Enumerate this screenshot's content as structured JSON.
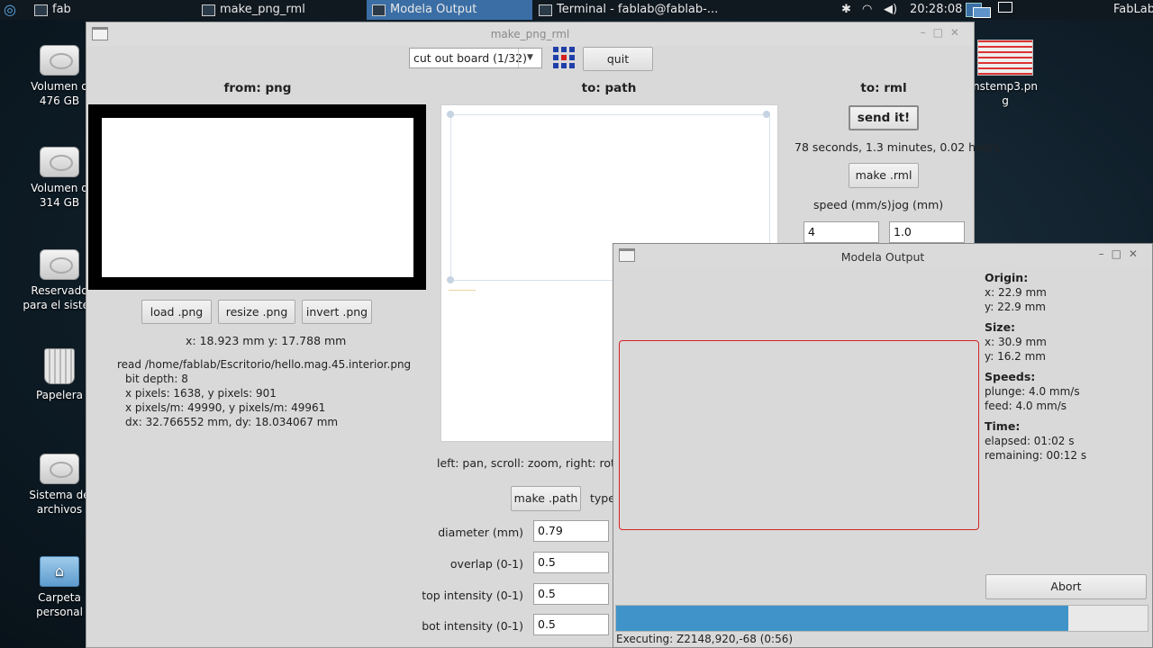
{
  "taskbar": {
    "items": [
      {
        "label": "fab"
      },
      {
        "label": "make_png_rml"
      },
      {
        "label": "Modela Output"
      },
      {
        "label": "Terminal - fablab@fablab-..."
      }
    ],
    "clock": "20:28:08",
    "user": "FabLab"
  },
  "desktop": {
    "icons": [
      {
        "label": "Volumen d\n476 GB"
      },
      {
        "label": "Volumen d\n314 GB"
      },
      {
        "label": "Reservado\npara el sisten"
      },
      {
        "label": "Papelera"
      },
      {
        "label": "Sistema de\narchivos"
      },
      {
        "label": "Carpeta\npersonal"
      },
      {
        "label": "nstemp3.pn\ng"
      }
    ]
  },
  "main_window": {
    "title": "make_png_rml",
    "mode_select": "cut out board (1/32)",
    "quit_label": "quit",
    "from_heading": "from: png",
    "path_heading": "to: path",
    "rml_heading": "to: rml",
    "load_png": "load .png",
    "resize_png": "resize .png",
    "invert_png": "invert .png",
    "cursor_coords": "x: 18.923 mm  y: 17.788 mm",
    "file_info": [
      "read /home/fablab/Escritorio/hello.mag.45.interior.png",
      "bit depth: 8",
      "x pixels: 1638, y pixels: 901",
      "x pixels/m: 49990, y pixels/m: 49961",
      "dx: 32.766552 mm, dy: 18.034067 mm"
    ],
    "nav_hint": "left: pan, scroll: zoom, right: rotate",
    "make_path": "make .path",
    "type_label": "type",
    "diameter_label": "diameter (mm)",
    "diameter_value": "0.79",
    "overlap_label": "overlap (0-1)",
    "overlap_value": "0.5",
    "top_intensity_label": "top intensity (0-1)",
    "top_intensity_value": "0.5",
    "bot_intensity_label": "bot intensity (0-1)",
    "bot_intensity_value": "0.5",
    "send_it": "send it!",
    "time_estimate": "78 seconds, 1.3 minutes, 0.02 hours",
    "make_rml": "make .rml",
    "speed_label": "speed (mm/s)",
    "jog_label": "jog (mm)",
    "speed_value": "4",
    "jog_value": "1.0"
  },
  "modela_window": {
    "title": "Modela Output",
    "origin_heading": "Origin:",
    "origin_x": "x: 22.9 mm",
    "origin_y": "y: 22.9 mm",
    "size_heading": "Size:",
    "size_x": "x: 30.9 mm",
    "size_y": "y: 16.2 mm",
    "speeds_heading": "Speeds:",
    "plunge": "plunge: 4.0 mm/s",
    "feed": "feed: 4.0 mm/s",
    "time_heading": "Time:",
    "elapsed": "elapsed: 01:02 s",
    "remaining": "remaining: 00:12 s",
    "abort_label": "Abort",
    "progress": 0.85,
    "executing": "Executing: Z2148,920,-68 (0:56)"
  },
  "colors": {
    "progress": "#3f93c9",
    "toolpath": "#d62222",
    "active_task": "#3a6ea5"
  }
}
